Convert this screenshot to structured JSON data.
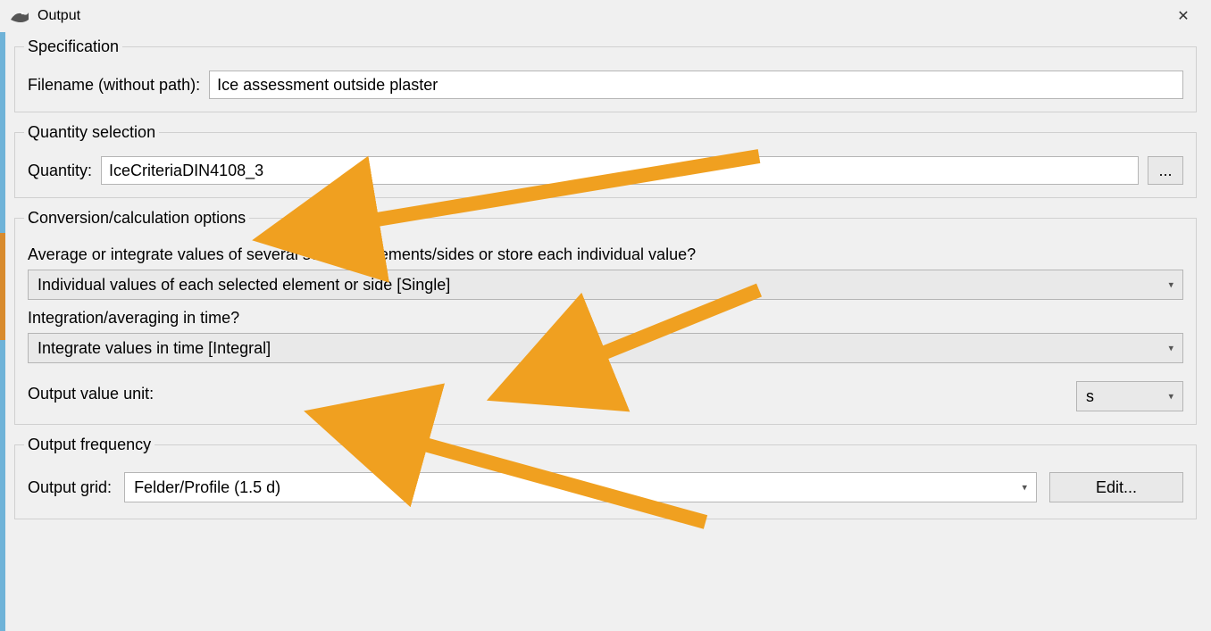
{
  "window": {
    "title": "Output",
    "close_glyph": "✕"
  },
  "specification": {
    "legend": "Specification",
    "filename_label": "Filename (without path):",
    "filename_value": "Ice assessment outside plaster"
  },
  "quantity_selection": {
    "legend": "Quantity selection",
    "quantity_label": "Quantity:",
    "quantity_value": "IceCriteriaDIN4108_3",
    "browse_label": "..."
  },
  "conversion": {
    "legend": "Conversion/calculation options",
    "avg_question": "Average or integrate values of several selected elements/sides or store each individual value?",
    "avg_value": "Individual values of each selected element or side [Single]",
    "time_question": "Integration/averaging in time?",
    "time_value": "Integrate values in time [Integral]",
    "unit_label": "Output value unit:",
    "unit_value": "s"
  },
  "frequency": {
    "legend": "Output frequency",
    "grid_label": "Output grid:",
    "grid_value": "Felder/Profile (1.5 d)",
    "edit_label": "Edit..."
  },
  "icons": {
    "chevron_down": "▾"
  },
  "annotations": {
    "arrow_color": "#f0a020"
  }
}
